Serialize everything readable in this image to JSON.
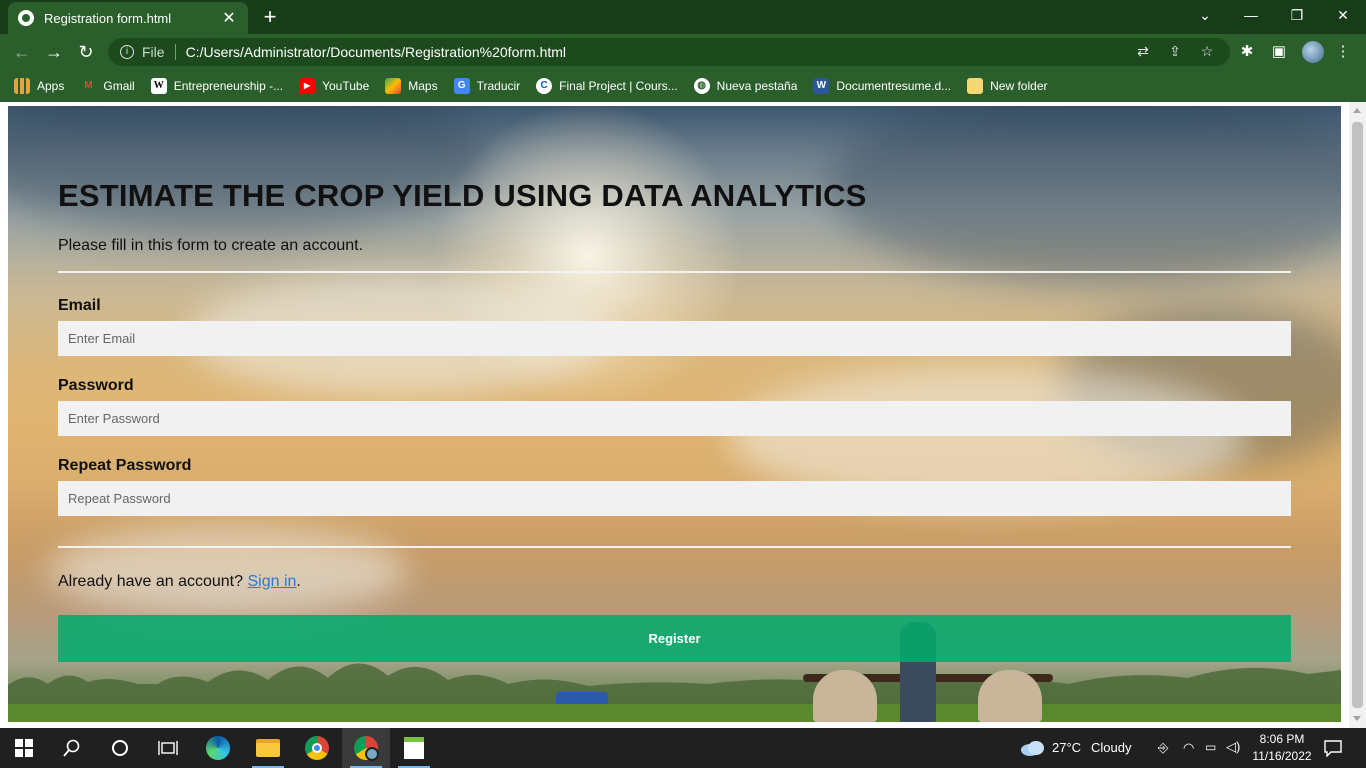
{
  "browser": {
    "tab_title": "Registration form.html",
    "address_scheme": "File",
    "address_url": "C:/Users/Administrator/Documents/Registration%20form.html",
    "bookmarks": [
      {
        "label": "Apps",
        "icon": "apps-grid-icon",
        "color": "#e8a33d"
      },
      {
        "label": "Gmail",
        "icon": "gmail-icon",
        "color": "#ea4335"
      },
      {
        "label": "Entrepreneurship -...",
        "icon": "wikipedia-icon",
        "color": "#ffffff"
      },
      {
        "label": "YouTube",
        "icon": "youtube-icon",
        "color": "#ff0000"
      },
      {
        "label": "Maps",
        "icon": "maps-icon",
        "color": "#34a853"
      },
      {
        "label": "Traducir",
        "icon": "translate-icon",
        "color": "#4285f4"
      },
      {
        "label": "Final Project | Cours...",
        "icon": "coursera-icon",
        "color": "#0056d2"
      },
      {
        "label": "Nueva pestaña",
        "icon": "globe-icon",
        "color": "#ffffff"
      },
      {
        "label": "Documentresume.d...",
        "icon": "word-icon",
        "color": "#2b579a"
      },
      {
        "label": "New folder",
        "icon": "folder-icon",
        "color": "#f7d774"
      }
    ]
  },
  "form": {
    "heading": "ESTIMATE THE CROP YIELD USING DATA ANALYTICS",
    "subtitle": "Please fill in this form to create an account.",
    "email_label": "Email",
    "email_placeholder": "Enter Email",
    "password_label": "Password",
    "password_placeholder": "Enter Password",
    "repeat_label": "Repeat Password",
    "repeat_placeholder": "Repeat Password",
    "signin_prefix": "Already have an account? ",
    "signin_link": "Sign in",
    "signin_suffix": ".",
    "register_label": "Register"
  },
  "taskbar": {
    "weather_temp": "27°C",
    "weather_desc": "Cloudy",
    "time": "8:06 PM",
    "date": "11/16/2022"
  },
  "colors": {
    "chrome_frame": "#173d18",
    "chrome_toolbar": "#2a5f2b",
    "register_button": "#04aa6d",
    "link": "#2b7ad1"
  }
}
